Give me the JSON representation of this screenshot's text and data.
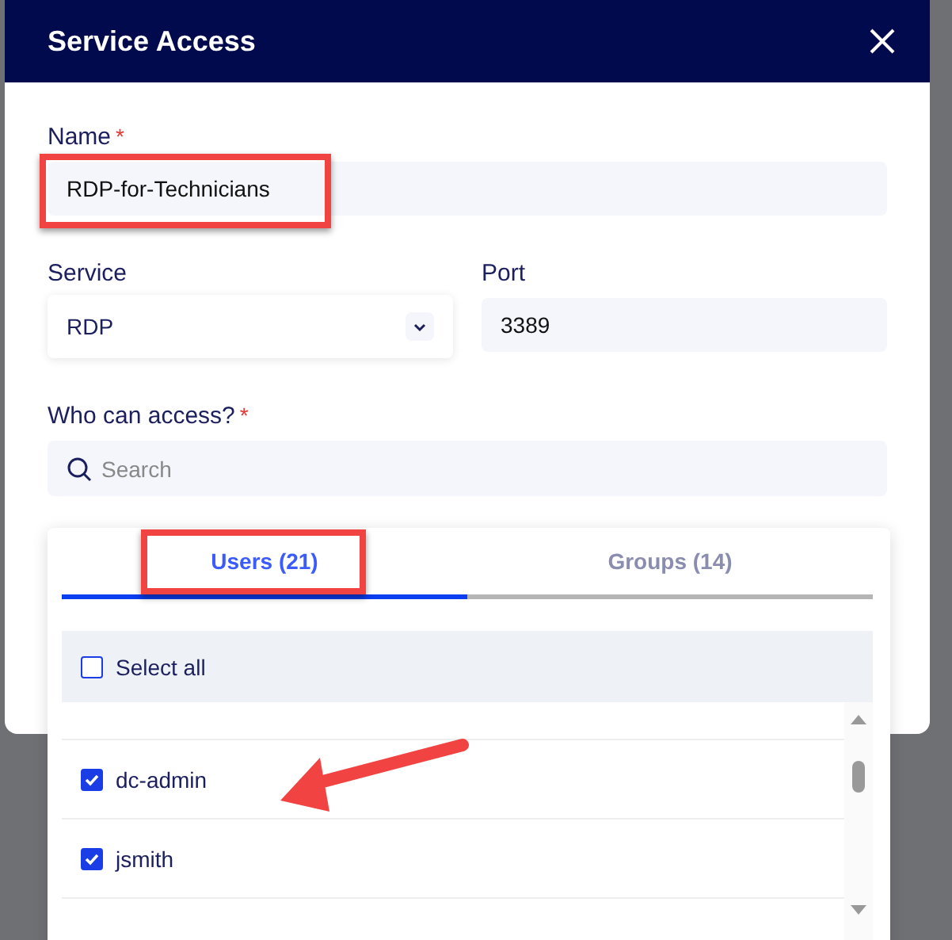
{
  "dialog": {
    "title": "Service Access"
  },
  "name": {
    "label": "Name",
    "required_mark": "*",
    "value": "RDP-for-Technicians"
  },
  "service": {
    "label": "Service",
    "value": "RDP"
  },
  "port": {
    "label": "Port",
    "value": "3389"
  },
  "access": {
    "label": "Who can access?",
    "required_mark": "*",
    "search": {
      "placeholder": "Search"
    }
  },
  "picker": {
    "tabs": [
      {
        "label": "Users (21)",
        "selected": true
      },
      {
        "label": "Groups (14)",
        "selected": false
      }
    ],
    "select_all": {
      "label": "Select all",
      "checked": false
    },
    "items": [
      {
        "label": "dc-admin",
        "checked": true
      },
      {
        "label": "jsmith",
        "checked": true
      }
    ]
  }
}
